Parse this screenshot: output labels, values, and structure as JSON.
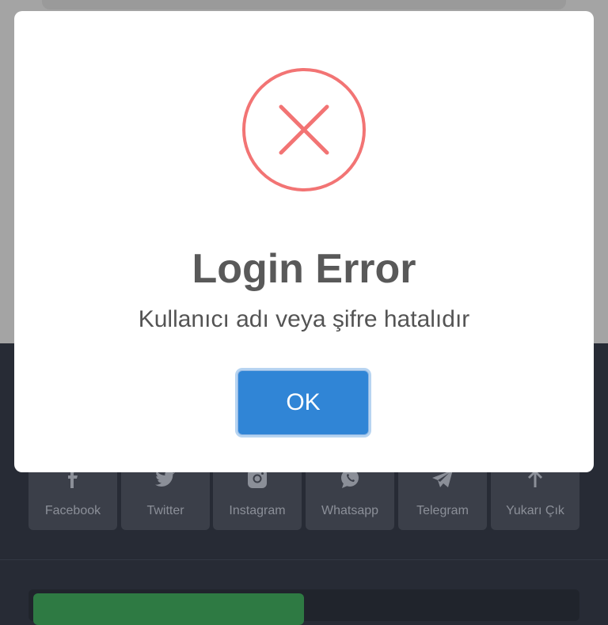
{
  "dialog": {
    "title": "Login Error",
    "message": "Kullanıcı adı veya şifre hatalıdır",
    "confirm_label": "OK",
    "icon": "error-x-icon",
    "icon_color": "#f27474",
    "button_color": "#3085d6"
  },
  "footer": {
    "social_buttons": [
      {
        "label": "Facebook",
        "icon": "facebook-icon"
      },
      {
        "label": "Twitter",
        "icon": "twitter-icon"
      },
      {
        "label": "Instagram",
        "icon": "instagram-icon"
      },
      {
        "label": "Whatsapp",
        "icon": "whatsapp-icon"
      },
      {
        "label": "Telegram",
        "icon": "telegram-icon"
      },
      {
        "label": "Yukarı Çık",
        "icon": "arrow-up-icon"
      }
    ],
    "background_color": "#272b35",
    "accent_color": "#2e7a43"
  }
}
